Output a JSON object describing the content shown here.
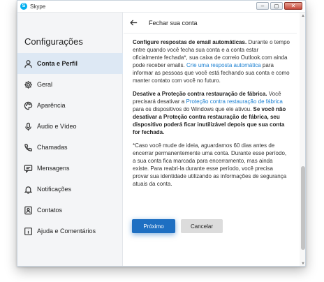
{
  "window": {
    "app_title": "Skype",
    "controls": {
      "minimize": "‒",
      "restore": "◻",
      "close": "✕"
    }
  },
  "sidebar": {
    "title": "Configurações",
    "items": [
      {
        "label": "Conta e Perfil",
        "icon": "user-icon",
        "active": true
      },
      {
        "label": "Geral",
        "icon": "gear-icon"
      },
      {
        "label": "Aparência",
        "icon": "palette-icon"
      },
      {
        "label": "Áudio e Vídeo",
        "icon": "microphone-icon"
      },
      {
        "label": "Chamadas",
        "icon": "phone-icon"
      },
      {
        "label": "Mensagens",
        "icon": "message-icon"
      },
      {
        "label": "Notificações",
        "icon": "bell-icon"
      },
      {
        "label": "Contatos",
        "icon": "contacts-icon"
      },
      {
        "label": "Ajuda e Comentários",
        "icon": "info-icon"
      }
    ]
  },
  "main": {
    "title": "Fechar sua conta",
    "para1": {
      "bold": "Configure respostas de email automáticas.",
      "text1": " Durante o tempo entre quando você fecha sua conta e a conta estar oficialmente fechada*, sua caixa de correio Outlook.com ainda pode receber emails. ",
      "link": "Crie uma resposta automática",
      "text2": " para informar as pessoas que você está fechando sua conta e como manter contato com você no futuro."
    },
    "para2": {
      "bold1": "Desative a Proteção contra restauração de fábrica.",
      "text1": " Você precisará desativar a ",
      "link": "Proteção contra restauração de fábrica",
      "text2": " para os dispositivos do Windows que ele ativou. ",
      "bold2": "Se você não desativar a Proteção contra restauração de fábrica, seu dispositivo poderá ficar inutilizável depois que sua conta for fechada."
    },
    "para3": "*Caso você mude de ideia, aguardamos 60 dias antes de encerrar permanentemente uma conta. Durante esse período, a sua conta fica marcada para encerramento, mas ainda existe. Para reabri-la durante esse período, você precisa provar sua identidade utilizando as informações de segurança atuais da conta.",
    "next_button": "Próximo",
    "cancel_button": "Cancelar"
  },
  "colors": {
    "accent": "#1e6fc2",
    "link": "#1a7fd1",
    "sidebar_bg": "#f4f5f7",
    "active_item_bg": "#dde8f4"
  }
}
